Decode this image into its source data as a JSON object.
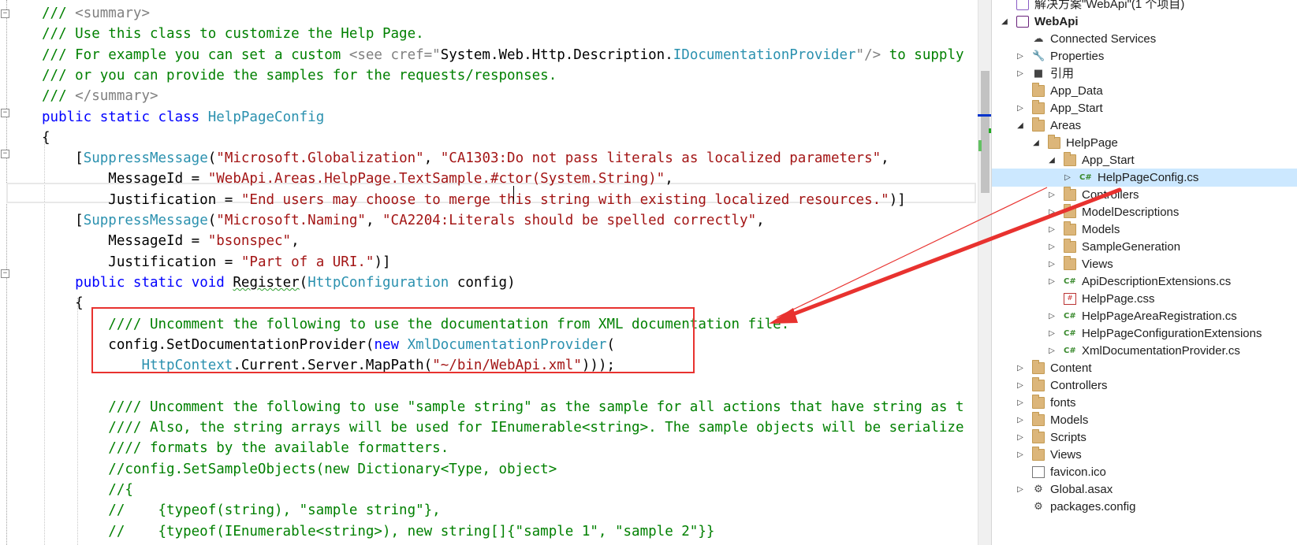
{
  "editor": {
    "lines": [
      [
        {
          "t": "/// ",
          "c": "comment"
        },
        {
          "t": "<summary>",
          "c": "doc"
        }
      ],
      [
        {
          "t": "/// Use this class to customize the Help Page.",
          "c": "comment"
        }
      ],
      [
        {
          "t": "/// For example you can set a custom ",
          "c": "comment"
        },
        {
          "t": "<see cref=\"",
          "c": "doc"
        },
        {
          "t": "System.Web.Http.Description.",
          "c": "plain"
        },
        {
          "t": "IDocumentationProvider",
          "c": "type"
        },
        {
          "t": "\"/>",
          "c": "doc"
        },
        {
          "t": " to supply",
          "c": "comment"
        }
      ],
      [
        {
          "t": "/// or you can provide the samples for the requests/responses.",
          "c": "comment"
        }
      ],
      [
        {
          "t": "/// ",
          "c": "comment"
        },
        {
          "t": "</summary>",
          "c": "doc"
        }
      ],
      [
        {
          "t": "public ",
          "c": "keyword"
        },
        {
          "t": "static ",
          "c": "keyword"
        },
        {
          "t": "class ",
          "c": "keyword"
        },
        {
          "t": "HelpPageConfig",
          "c": "type"
        }
      ],
      [
        {
          "t": "{",
          "c": "plain"
        }
      ],
      [
        {
          "t": "    [",
          "c": "plain"
        },
        {
          "t": "SuppressMessage",
          "c": "type"
        },
        {
          "t": "(",
          "c": "plain"
        },
        {
          "t": "\"Microsoft.Globalization\"",
          "c": "string"
        },
        {
          "t": ", ",
          "c": "plain"
        },
        {
          "t": "\"CA1303:Do not pass literals as localized parameters\"",
          "c": "string"
        },
        {
          "t": ",",
          "c": "plain"
        }
      ],
      [
        {
          "t": "        MessageId = ",
          "c": "plain"
        },
        {
          "t": "\"WebApi.Areas.HelpPage.TextSample.#ctor(System.String)\"",
          "c": "string"
        },
        {
          "t": ",",
          "c": "plain"
        }
      ],
      [
        {
          "t": "        Justification = ",
          "c": "plain"
        },
        {
          "t": "\"End users may choose to merge this string with existing localized resources.\"",
          "c": "string"
        },
        {
          "t": ")]",
          "c": "plain"
        }
      ],
      [
        {
          "t": "    [",
          "c": "plain"
        },
        {
          "t": "SuppressMessage",
          "c": "type"
        },
        {
          "t": "(",
          "c": "plain"
        },
        {
          "t": "\"Microsoft.Naming\"",
          "c": "string"
        },
        {
          "t": ", ",
          "c": "plain"
        },
        {
          "t": "\"CA2204:Literals should be spelled correctly\"",
          "c": "string"
        },
        {
          "t": ",",
          "c": "plain"
        }
      ],
      [
        {
          "t": "        MessageId = ",
          "c": "plain"
        },
        {
          "t": "\"bsonspec\"",
          "c": "string"
        },
        {
          "t": ",",
          "c": "plain"
        }
      ],
      [
        {
          "t": "        Justification = ",
          "c": "plain"
        },
        {
          "t": "\"Part of a URI.\"",
          "c": "string"
        },
        {
          "t": ")]",
          "c": "plain"
        }
      ],
      [
        {
          "t": "    ",
          "c": "plain"
        },
        {
          "t": "public ",
          "c": "keyword"
        },
        {
          "t": "static ",
          "c": "keyword"
        },
        {
          "t": "void ",
          "c": "keyword"
        },
        {
          "t": "Register",
          "c": "plain",
          "sq": true
        },
        {
          "t": "(",
          "c": "plain"
        },
        {
          "t": "HttpConfiguration",
          "c": "type"
        },
        {
          "t": " config)",
          "c": "plain"
        }
      ],
      [
        {
          "t": "    {",
          "c": "plain"
        }
      ],
      [
        {
          "t": "        //// Uncomment the following to use the documentation from XML documentation file.",
          "c": "comment"
        }
      ],
      [
        {
          "t": "        config.SetDocumentationProvider(",
          "c": "plain"
        },
        {
          "t": "new ",
          "c": "keyword"
        },
        {
          "t": "XmlDocumentationProvider",
          "c": "type"
        },
        {
          "t": "(",
          "c": "plain"
        }
      ],
      [
        {
          "t": "            ",
          "c": "plain"
        },
        {
          "t": "HttpContext",
          "c": "type"
        },
        {
          "t": ".Current.Server.MapPath(",
          "c": "plain"
        },
        {
          "t": "\"~/bin/WebApi.xml\"",
          "c": "string"
        },
        {
          "t": ")));",
          "c": "plain"
        }
      ],
      [
        {
          "t": "",
          "c": "plain"
        }
      ],
      [
        {
          "t": "        //// Uncomment the following to use \"sample string\" as the sample for all actions that have string as t",
          "c": "comment"
        }
      ],
      [
        {
          "t": "        //// Also, the string arrays will be used for IEnumerable<string>. The sample objects will be serialize",
          "c": "comment"
        }
      ],
      [
        {
          "t": "        //// formats by the available formatters.",
          "c": "comment"
        }
      ],
      [
        {
          "t": "        //config.SetSampleObjects(new Dictionary<Type, object>",
          "c": "comment"
        }
      ],
      [
        {
          "t": "        //{",
          "c": "comment"
        }
      ],
      [
        {
          "t": "        //    {typeof(string), \"sample string\"},",
          "c": "comment"
        }
      ],
      [
        {
          "t": "        //    {typeof(IEnumerable<string>), new string[]{\"sample 1\", \"sample 2\"}}",
          "c": "comment"
        }
      ]
    ]
  },
  "explorer": {
    "items": [
      {
        "label": "解决方案\"WebApi\"(1 个项目)",
        "icon": "solution-icon",
        "depth": 0,
        "expander": ""
      },
      {
        "label": "WebApi",
        "icon": "project-icon",
        "depth": 0,
        "expander": "open",
        "bold": true
      },
      {
        "label": "Connected Services",
        "icon": "connected-services-icon",
        "depth": 1,
        "expander": ""
      },
      {
        "label": "Properties",
        "icon": "wrench-icon",
        "depth": 1,
        "expander": "closed"
      },
      {
        "label": "引用",
        "icon": "references-icon",
        "depth": 1,
        "expander": "closed"
      },
      {
        "label": "App_Data",
        "icon": "folder-icon",
        "depth": 1,
        "expander": ""
      },
      {
        "label": "App_Start",
        "icon": "folder-icon",
        "depth": 1,
        "expander": "closed"
      },
      {
        "label": "Areas",
        "icon": "folder-open-icon",
        "depth": 1,
        "expander": "open"
      },
      {
        "label": "HelpPage",
        "icon": "folder-open-icon",
        "depth": 2,
        "expander": "open"
      },
      {
        "label": "App_Start",
        "icon": "folder-open-icon",
        "depth": 3,
        "expander": "open"
      },
      {
        "label": "HelpPageConfig.cs",
        "icon": "csharp-file-icon",
        "depth": 4,
        "expander": "closed",
        "selected": true
      },
      {
        "label": "Controllers",
        "icon": "folder-icon",
        "depth": 3,
        "expander": "closed"
      },
      {
        "label": "ModelDescriptions",
        "icon": "folder-icon",
        "depth": 3,
        "expander": "closed"
      },
      {
        "label": "Models",
        "icon": "folder-icon",
        "depth": 3,
        "expander": "closed"
      },
      {
        "label": "SampleGeneration",
        "icon": "folder-icon",
        "depth": 3,
        "expander": "closed"
      },
      {
        "label": "Views",
        "icon": "folder-icon",
        "depth": 3,
        "expander": "closed"
      },
      {
        "label": "ApiDescriptionExtensions.cs",
        "icon": "csharp-file-icon",
        "depth": 3,
        "expander": "closed"
      },
      {
        "label": "HelpPage.css",
        "icon": "css-file-icon",
        "depth": 3,
        "expander": ""
      },
      {
        "label": "HelpPageAreaRegistration.cs",
        "icon": "csharp-file-icon",
        "depth": 3,
        "expander": "closed"
      },
      {
        "label": "HelpPageConfigurationExtensions",
        "icon": "csharp-file-icon",
        "depth": 3,
        "expander": "closed"
      },
      {
        "label": "XmlDocumentationProvider.cs",
        "icon": "csharp-file-icon",
        "depth": 3,
        "expander": "closed"
      },
      {
        "label": "Content",
        "icon": "folder-icon",
        "depth": 1,
        "expander": "closed"
      },
      {
        "label": "Controllers",
        "icon": "folder-icon",
        "depth": 1,
        "expander": "closed"
      },
      {
        "label": "fonts",
        "icon": "folder-icon",
        "depth": 1,
        "expander": "closed"
      },
      {
        "label": "Models",
        "icon": "folder-icon",
        "depth": 1,
        "expander": "closed"
      },
      {
        "label": "Scripts",
        "icon": "folder-icon",
        "depth": 1,
        "expander": "closed"
      },
      {
        "label": "Views",
        "icon": "folder-icon",
        "depth": 1,
        "expander": "closed"
      },
      {
        "label": "favicon.ico",
        "icon": "file-icon",
        "depth": 1,
        "expander": ""
      },
      {
        "label": "Global.asax",
        "icon": "gear-file-icon",
        "depth": 1,
        "expander": "closed"
      },
      {
        "label": "packages.config",
        "icon": "config-file-icon",
        "depth": 1,
        "expander": ""
      }
    ]
  },
  "colors": {
    "comment": "#008000",
    "keyword": "#0000ff",
    "type": "#2b91af",
    "string": "#a31515",
    "doc": "#808080",
    "annotation": "#e8322f",
    "selection": "#cce8ff"
  }
}
